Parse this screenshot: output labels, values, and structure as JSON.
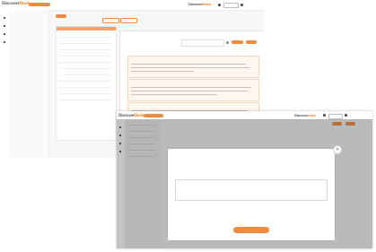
{
  "colors": {
    "accent": "#f08a3c",
    "accent_light": "#fef6ef",
    "overlay": "#282828"
  },
  "back_window": {
    "logo": {
      "part1": "Discover",
      "part2": "Deck"
    },
    "header_button": "",
    "brand_logo": {
      "part1": "Discover",
      "part2": "Deck"
    },
    "user_button": "",
    "user_menu": "",
    "crumb": "",
    "title_small": "",
    "title_pills": [
      "",
      ""
    ],
    "list_items": [
      "",
      "",
      "",
      "",
      "",
      "",
      "",
      "",
      "",
      "",
      "",
      ""
    ],
    "chat": {
      "title": "",
      "search_placeholder": "",
      "tabs": [
        "",
        ""
      ],
      "cards": [
        {
          "title": "",
          "tag": ""
        },
        {
          "title": "",
          "tag": ""
        },
        {
          "title": "",
          "tag": ""
        },
        {
          "title": "",
          "tag": ""
        }
      ]
    }
  },
  "front_window": {
    "logo": {
      "part1": "Discover",
      "part2": "Deck"
    },
    "header_button": "",
    "brand_logo": {
      "part1": "Discover",
      "part2": "Deck"
    },
    "modal": {
      "title": "",
      "textarea_placeholder": "",
      "submit_button": ""
    }
  },
  "icons": [
    "menu-icon",
    "notification-icon",
    "user-icon",
    "close-icon",
    "search-icon"
  ]
}
